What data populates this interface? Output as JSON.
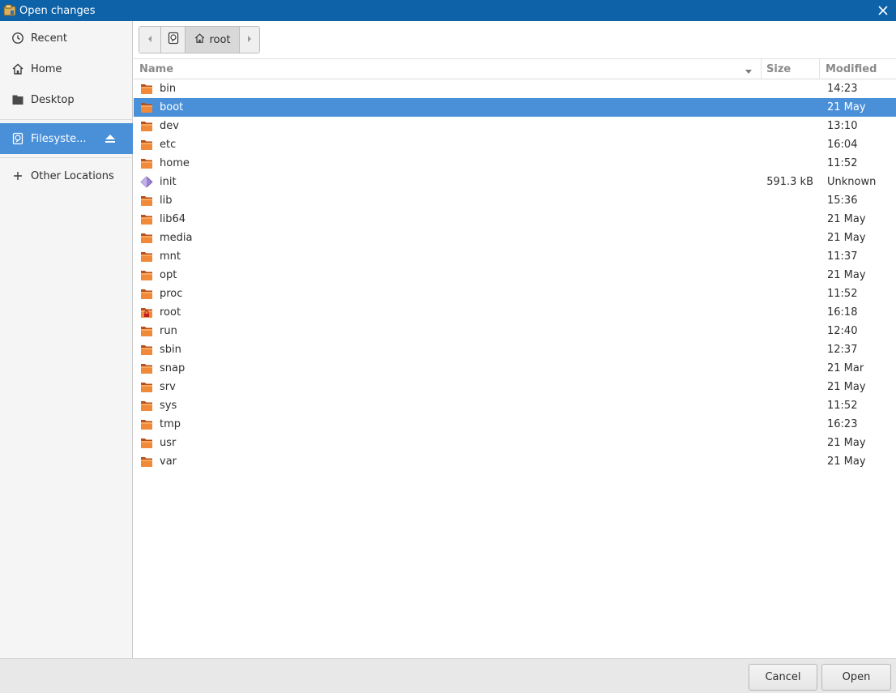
{
  "window": {
    "title": "Open changes"
  },
  "sidebar": {
    "items": [
      {
        "label": "Recent",
        "icon": "clock-icon"
      },
      {
        "label": "Home",
        "icon": "home-icon"
      },
      {
        "label": "Desktop",
        "icon": "desktop-icon"
      },
      {
        "label": "Filesyste...",
        "icon": "drive-icon",
        "active": true
      },
      {
        "label": "Other Locations",
        "icon": "plus-icon"
      }
    ]
  },
  "pathbar": {
    "current": "root"
  },
  "columns": {
    "name": "Name",
    "size": "Size",
    "modified": "Modified"
  },
  "files": [
    {
      "name": "bin",
      "size": "",
      "modified": "14:23",
      "type": "folder"
    },
    {
      "name": "boot",
      "size": "",
      "modified": "21 May",
      "type": "folder",
      "selected": true
    },
    {
      "name": "dev",
      "size": "",
      "modified": "13:10",
      "type": "folder"
    },
    {
      "name": "etc",
      "size": "",
      "modified": "16:04",
      "type": "folder"
    },
    {
      "name": "home",
      "size": "",
      "modified": "11:52",
      "type": "folder"
    },
    {
      "name": "init",
      "size": "591.3 kB",
      "modified": "Unknown",
      "type": "file"
    },
    {
      "name": "lib",
      "size": "",
      "modified": "15:36",
      "type": "folder"
    },
    {
      "name": "lib64",
      "size": "",
      "modified": "21 May",
      "type": "folder"
    },
    {
      "name": "media",
      "size": "",
      "modified": "21 May",
      "type": "folder"
    },
    {
      "name": "mnt",
      "size": "",
      "modified": "11:37",
      "type": "folder"
    },
    {
      "name": "opt",
      "size": "",
      "modified": "21 May",
      "type": "folder"
    },
    {
      "name": "proc",
      "size": "",
      "modified": "11:52",
      "type": "folder"
    },
    {
      "name": "root",
      "size": "",
      "modified": "16:18",
      "type": "folder-locked"
    },
    {
      "name": "run",
      "size": "",
      "modified": "12:40",
      "type": "folder"
    },
    {
      "name": "sbin",
      "size": "",
      "modified": "12:37",
      "type": "folder"
    },
    {
      "name": "snap",
      "size": "",
      "modified": "21 Mar",
      "type": "folder"
    },
    {
      "name": "srv",
      "size": "",
      "modified": "21 May",
      "type": "folder"
    },
    {
      "name": "sys",
      "size": "",
      "modified": "11:52",
      "type": "folder"
    },
    {
      "name": "tmp",
      "size": "",
      "modified": "16:23",
      "type": "folder"
    },
    {
      "name": "usr",
      "size": "",
      "modified": "21 May",
      "type": "folder"
    },
    {
      "name": "var",
      "size": "",
      "modified": "21 May",
      "type": "folder"
    }
  ],
  "buttons": {
    "cancel": "Cancel",
    "open": "Open"
  },
  "colors": {
    "titlebar": "#0d62a8",
    "selection": "#4a90d9",
    "folder": "#e8782e"
  }
}
